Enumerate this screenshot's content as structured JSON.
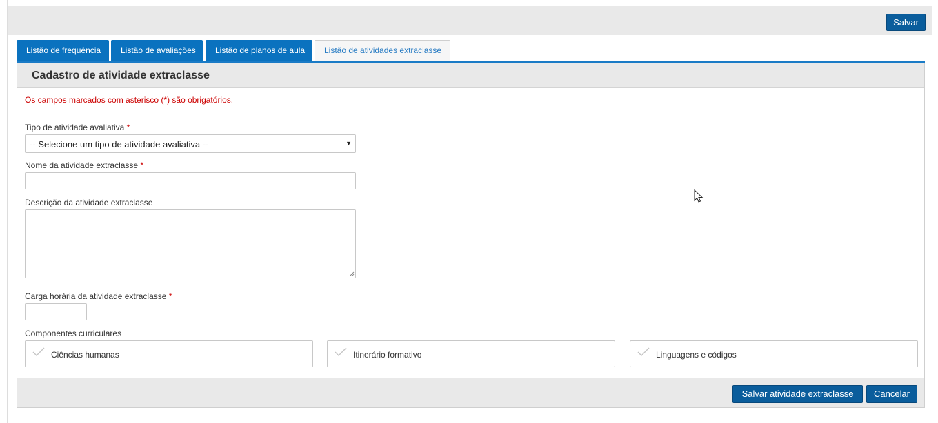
{
  "toolbar": {
    "save_label": "Salvar"
  },
  "tabs": [
    {
      "label": "Listão de frequência",
      "active": false
    },
    {
      "label": "Listão de avaliações",
      "active": false
    },
    {
      "label": "Listão de planos de aula",
      "active": false
    },
    {
      "label": "Listão de atividades extraclasse",
      "active": true
    }
  ],
  "form": {
    "title": "Cadastro de atividade extraclasse",
    "required_note": "Os campos marcados com asterisco (*) são obrigatórios.",
    "tipo": {
      "label": "Tipo de atividade avaliativa",
      "required_mark": "*",
      "selected": "-- Selecione um tipo de atividade avaliativa --"
    },
    "nome": {
      "label": "Nome da atividade extraclasse",
      "required_mark": "*",
      "value": ""
    },
    "descricao": {
      "label": "Descrição da atividade extraclasse",
      "value": ""
    },
    "carga": {
      "label": "Carga horária da atividade extraclasse",
      "required_mark": "*",
      "value": ""
    },
    "componentes": {
      "label": "Componentes curriculares",
      "items": [
        {
          "label": "Ciências humanas",
          "checked": false
        },
        {
          "label": "Itinerário formativo",
          "checked": false
        },
        {
          "label": "Linguagens e códigos",
          "checked": false
        }
      ]
    }
  },
  "footer": {
    "save_label": "Salvar atividade extraclasse",
    "cancel_label": "Cancelar"
  },
  "colors": {
    "primary_button": "#0a5d9c",
    "tab_blue": "#0a72bf",
    "required_red": "#cc0000",
    "panel_gray": "#e9e9e9"
  }
}
